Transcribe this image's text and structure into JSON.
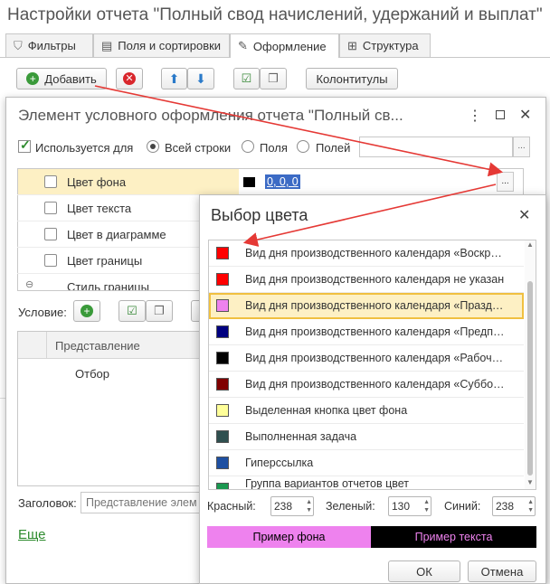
{
  "report_title": "Настройки отчета \"Полный свод начислений, удержаний и выплат\"",
  "tabs": [
    {
      "label": "Фильтры",
      "icon": "filter-icon"
    },
    {
      "label": "Поля и сортировки",
      "icon": "table-icon"
    },
    {
      "label": "Оформление",
      "icon": "brush-icon",
      "active": true
    },
    {
      "label": "Структура",
      "icon": "structure-icon"
    }
  ],
  "toolbar": {
    "add_label": "Добавить",
    "footer_label": "Колонтитулы"
  },
  "element_dialog": {
    "title": "Элемент условного оформления отчета \"Полный св...",
    "used_for_label": "Используется для",
    "radio_all": "Всей строки",
    "radio_fields": "Поля",
    "radio_fields2": "Полей",
    "props": [
      {
        "label": "Цвет фона",
        "value": "0, 0, 0"
      },
      {
        "label": "Цвет текста"
      },
      {
        "label": "Цвет в диаграмме"
      },
      {
        "label": "Цвет границы"
      },
      {
        "label": "Стиль границы"
      }
    ],
    "condition_label": "Условие:",
    "table_header": "Представление",
    "table_row": "Отбор",
    "caption_label": "Заголовок:",
    "caption_placeholder": "Представление элем",
    "more_link": "Еще"
  },
  "color_dialog": {
    "title": "Выбор цвета",
    "items": [
      {
        "label": "Вид дня производственного календаря «Воскр…",
        "color": "#ff0000"
      },
      {
        "label": "Вид дня производственного календаря не указан",
        "color": "#ff0000"
      },
      {
        "label": "Вид дня производственного календаря «Празд…",
        "color": "#ee82ee",
        "selected": true
      },
      {
        "label": "Вид дня производственного календаря «Предп…",
        "color": "#000080"
      },
      {
        "label": "Вид дня производственного календаря «Рабоч…",
        "color": "#000000"
      },
      {
        "label": "Вид дня производственного календаря «Суббо…",
        "color": "#800000"
      },
      {
        "label": "Выделенная кнопка цвет фона",
        "color": "#ffff99"
      },
      {
        "label": "Выполненная задача",
        "color": "#2f4f4f"
      },
      {
        "label": "Гиперссылка",
        "color": "#1e50a2"
      },
      {
        "label": "Группа вариантов отчетов цвет",
        "color": "#1a9850"
      }
    ],
    "red_label": "Красный:",
    "red_value": "238",
    "green_label": "Зеленый:",
    "green_value": "130",
    "blue_label": "Синий:",
    "blue_value": "238",
    "bg_sample": "Пример фона",
    "text_sample": "Пример текста",
    "ok": "ОК",
    "cancel": "Отмена",
    "sample_bg_color": "#ee82ee"
  }
}
